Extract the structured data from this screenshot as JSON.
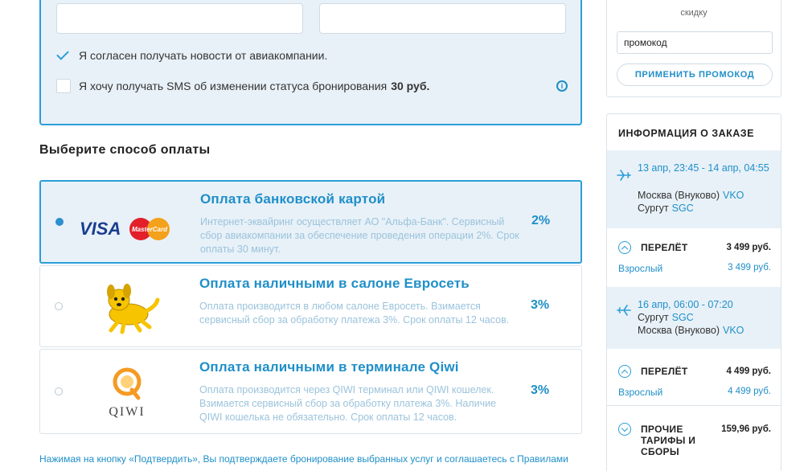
{
  "contact": {
    "news_checkbox_label": "Я согласен получать новости от авиакомпании.",
    "news_checked": true,
    "sms_checkbox_label": "Я хочу получать SMS об изменении статуса бронирования",
    "sms_price": "30 руб.",
    "sms_checked": false
  },
  "payment": {
    "section_title": "Выберите способ оплаты",
    "options": [
      {
        "title": "Оплата банковской картой",
        "description": "Интернет-эквайринг осуществляет АО \"Альфа-Банк\". Сервисный сбор авиакомпании за обеспечение проведения операции 2%. Срок оплаты 30 минут.",
        "fee": "2%",
        "selected": true,
        "logo": "visa-mastercard-logo"
      },
      {
        "title": "Оплата наличными в салоне Евросеть",
        "description": "Оплата производится в любом салоне Евросеть. Взимается сервисный сбор за обработку платежа 3%. Срок оплаты 12 часов.",
        "fee": "3%",
        "selected": false,
        "logo": "euroset-dog-logo"
      },
      {
        "title": "Оплата наличными в терминале Qiwi",
        "description": "Оплата производится через QIWI терминал или QIWI кошелек. Взимается сервисный сбор за обработку платежа 3%. Наличие QIWI кошелька не обязательно. Срок оплаты 12 часов.",
        "fee": "3%",
        "selected": false,
        "logo": "qiwi-logo"
      }
    ],
    "visa_text": "VISA",
    "mastercard_text": "MasterCard",
    "qiwi_text": "QIWI"
  },
  "disclaimer": "Нажимая на кнопку «Подтвердить», Вы подтверждаете бронирование выбранных услуг и соглашаетесь с Правилами",
  "promo": {
    "caption": "скидку",
    "input_value": "промокод",
    "apply_label": "ПРИМЕНИТЬ ПРОМОКОД"
  },
  "order": {
    "title": "ИНФОРМАЦИЯ О ЗАКАЗЕ",
    "flights": [
      {
        "time": "13 апр, 23:45 - 14 апр, 04:55",
        "from_city": "Москва (Внуково)",
        "from_code": "VKO",
        "to_city": "Сургут",
        "to_code": "SGC",
        "segment_label": "ПЕРЕЛЁТ",
        "segment_price": "3 499 руб.",
        "passenger": "Взрослый",
        "passenger_price": "3 499 руб."
      },
      {
        "time": "16 апр, 06:00 - 07:20",
        "from_city": "Сургут",
        "from_code": "SGC",
        "to_city": "Москва (Внуково)",
        "to_code": "VKO",
        "segment_label": "ПЕРЕЛЁТ",
        "segment_price": "4 499 руб.",
        "passenger": "Взрослый",
        "passenger_price": "4 499 руб."
      }
    ],
    "other_fees_label": "ПРОЧИЕ ТАРИФЫ И СБОРЫ",
    "other_fees_price": "159,96 руб."
  },
  "colors": {
    "accent": "#2b9ed8",
    "link": "#1f8fc8",
    "panel_bg": "#e8f1f8"
  }
}
